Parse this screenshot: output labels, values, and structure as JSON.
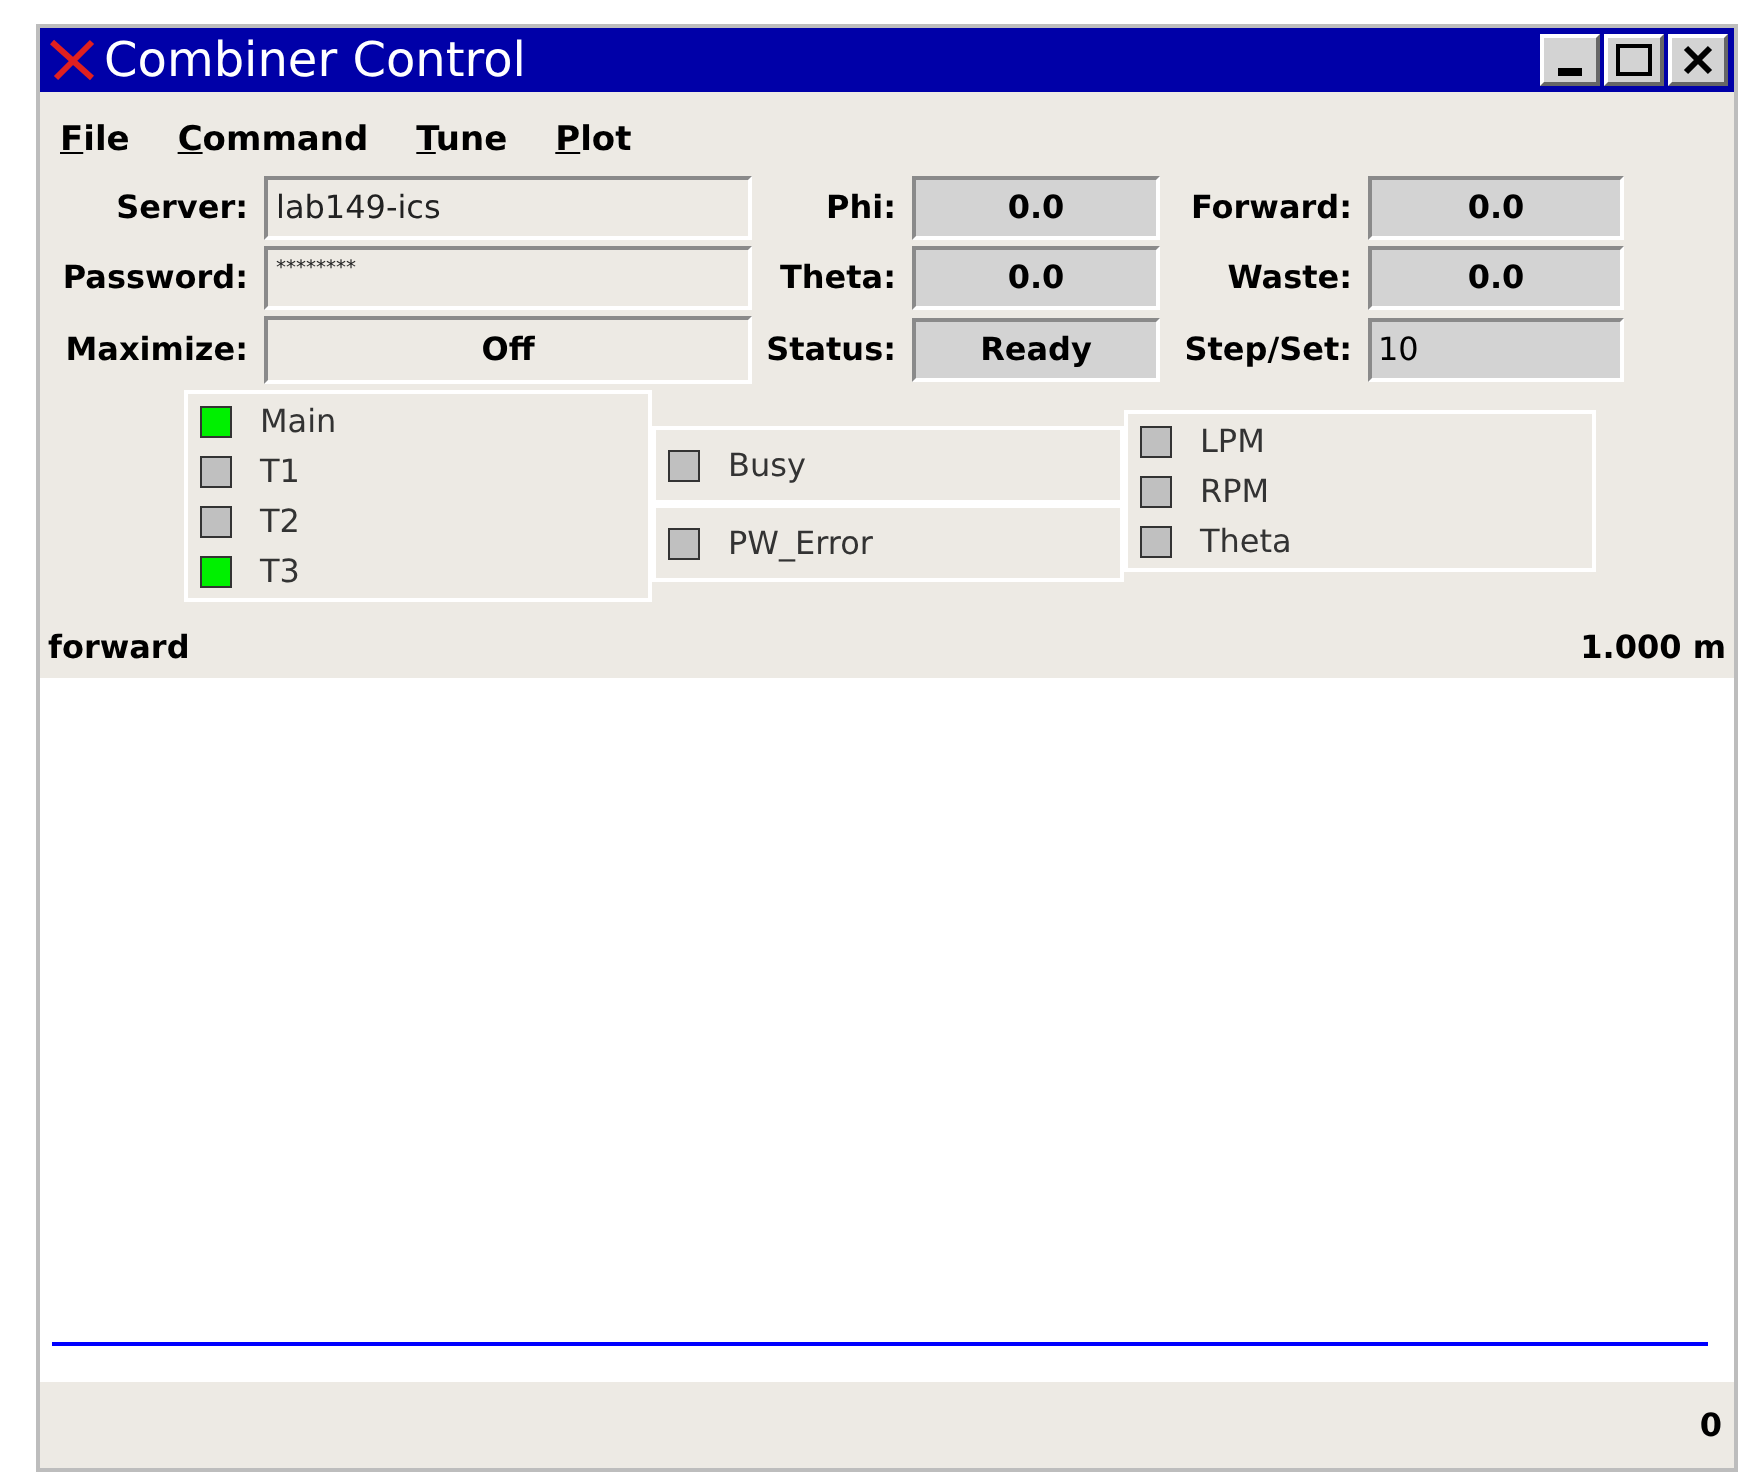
{
  "window": {
    "title": "Combiner Control"
  },
  "menu": [
    {
      "label": "File"
    },
    {
      "label": "Command"
    },
    {
      "label": "Tune"
    },
    {
      "label": "Plot"
    }
  ],
  "form_rows": [
    [
      {
        "label": "Server:",
        "kind": "entry",
        "value": "lab149-ics"
      },
      {
        "label": "Phi:",
        "kind": "readout",
        "value": "0.0"
      },
      {
        "label": "Forward:",
        "kind": "readout",
        "value": "0.0"
      }
    ],
    [
      {
        "label": "Password:",
        "kind": "password",
        "value": "********"
      },
      {
        "label": "Theta:",
        "kind": "readout",
        "value": "0.0"
      },
      {
        "label": "Waste:",
        "kind": "readout",
        "value": "0.0"
      }
    ],
    [
      {
        "label": "Maximize:",
        "kind": "toggle",
        "value": "Off"
      },
      {
        "label": "Status:",
        "kind": "readout",
        "value": "Ready"
      },
      {
        "label": "Step/Set:",
        "kind": "setpoint",
        "value": "10"
      }
    ]
  ],
  "indicator_columns": [
    [
      [
        {
          "label": "Main",
          "on": true
        },
        {
          "label": "T1",
          "on": false
        },
        {
          "label": "T2",
          "on": false
        },
        {
          "label": "T3",
          "on": true
        }
      ]
    ],
    [
      [
        {
          "label": "Busy",
          "on": false
        }
      ],
      [
        {
          "label": "PW_Error",
          "on": false
        }
      ]
    ],
    [
      [
        {
          "label": "LPM",
          "on": false
        },
        {
          "label": "RPM",
          "on": false
        },
        {
          "label": "Theta",
          "on": false
        }
      ]
    ]
  ],
  "plot": {
    "trace_label": "forward",
    "top_scale": "1.000 m",
    "bottom_scale": "0"
  }
}
